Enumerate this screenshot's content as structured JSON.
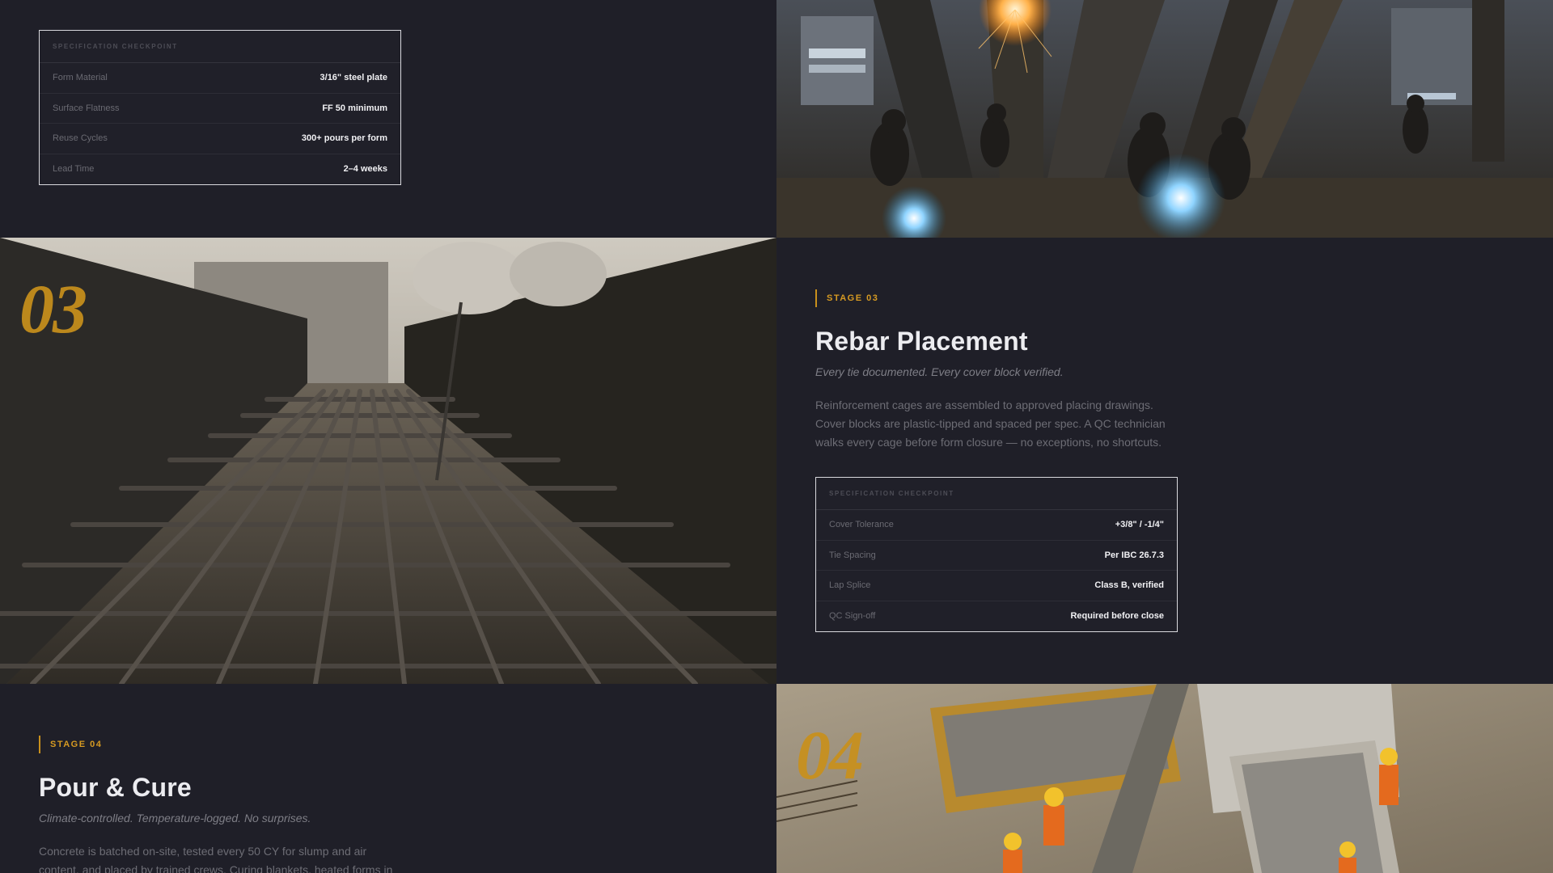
{
  "stage02": {
    "spec": {
      "heading": "SPECIFICATION CHECKPOINT",
      "rows": [
        {
          "key": "Form Material",
          "value": "3/16\" steel plate"
        },
        {
          "key": "Surface Flatness",
          "value": "FF 50 minimum"
        },
        {
          "key": "Reuse Cycles",
          "value": "300+ pours per form"
        },
        {
          "key": "Lead Time",
          "value": "2–4 weeks"
        }
      ]
    },
    "photo_icon": "welding-workshop-photo"
  },
  "stage03": {
    "number": "03",
    "label": "STAGE 03",
    "title": "Rebar Placement",
    "tagline": "Every tie documented. Every cover block verified.",
    "body": "Reinforcement cages are assembled to approved placing drawings. Cover blocks are plastic-tipped and spaced per spec. A QC technician walks every cage before form closure — no exceptions, no shortcuts.",
    "spec": {
      "heading": "SPECIFICATION CHECKPOINT",
      "rows": [
        {
          "key": "Cover Tolerance",
          "value": "+3/8\" / -1/4\""
        },
        {
          "key": "Tie Spacing",
          "value": "Per IBC 26.7.3"
        },
        {
          "key": "Lap Splice",
          "value": "Class B, verified"
        },
        {
          "key": "QC Sign-off",
          "value": "Required before close"
        }
      ]
    },
    "photo_icon": "rebar-grid-photo"
  },
  "stage04": {
    "number": "04",
    "label": "STAGE 04",
    "title": "Pour & Cure",
    "tagline": "Climate-controlled. Temperature-logged. No surprises.",
    "body": "Concrete is batched on-site, tested every 50 CY for slump and air content, and placed by trained crews. Curing blankets, heated forms in",
    "photo_icon": "concrete-pour-photo"
  },
  "colors": {
    "background": "#1f1f28",
    "accent": "#c9901c",
    "card_border": "#d9d9de"
  }
}
